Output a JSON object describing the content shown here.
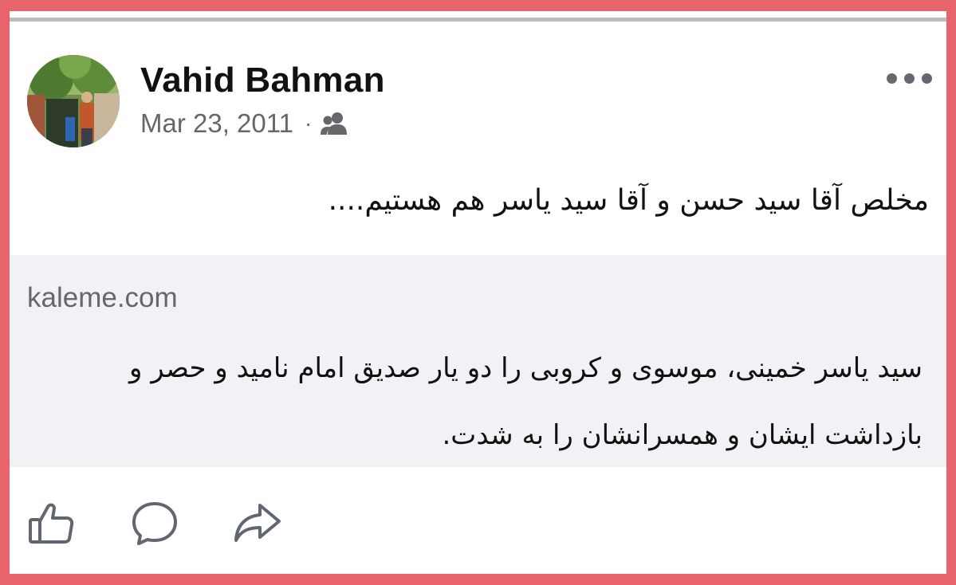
{
  "post": {
    "author": "Vahid Bahman",
    "date": "Mar 23, 2011",
    "separator": "·",
    "audience_icon": "friends-icon",
    "text": "مخلص آقا سید حسن و آقا سید یاسر هم هستیم....",
    "more_icon": "more-options-icon"
  },
  "link_preview": {
    "domain": "kaleme.com",
    "title": "سید یاسر خمینی، موسوی و کروبی را دو یار صدیق امام نامید و حصر و بازداشت ایشان و همسرانشان را به شدت."
  },
  "actions": {
    "like_icon": "like-icon",
    "comment_icon": "comment-icon",
    "share_icon": "share-icon"
  },
  "colors": {
    "frame": "#e8646d",
    "secondary_text": "#65676b",
    "preview_bg": "#f0f2f5"
  }
}
